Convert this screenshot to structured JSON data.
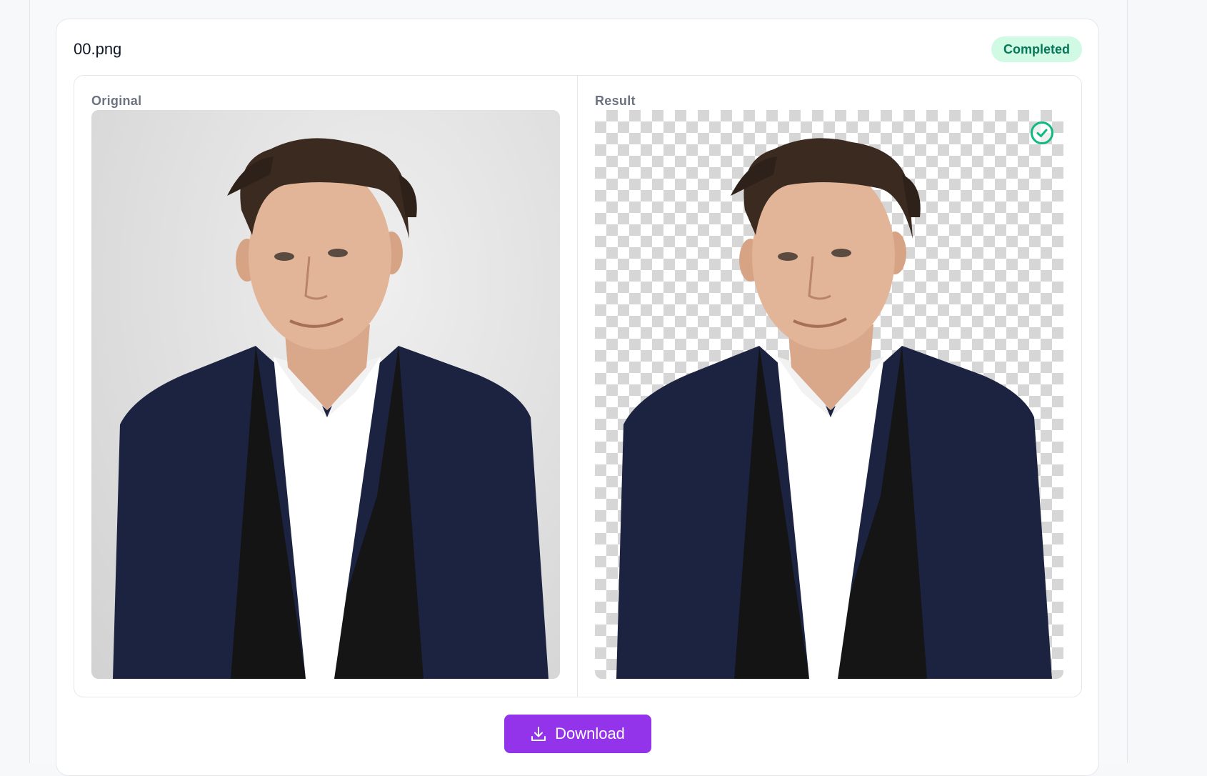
{
  "file": {
    "name": "00.png",
    "status": "Completed"
  },
  "panels": {
    "original_label": "Original",
    "result_label": "Result"
  },
  "actions": {
    "download_label": "Download"
  },
  "icons": {
    "status": "check-circle-icon",
    "download": "download-icon"
  },
  "colors": {
    "accent": "#9333ea",
    "success_bg": "#d1fae5",
    "success_text": "#047857",
    "check_ring": "#10b981"
  }
}
